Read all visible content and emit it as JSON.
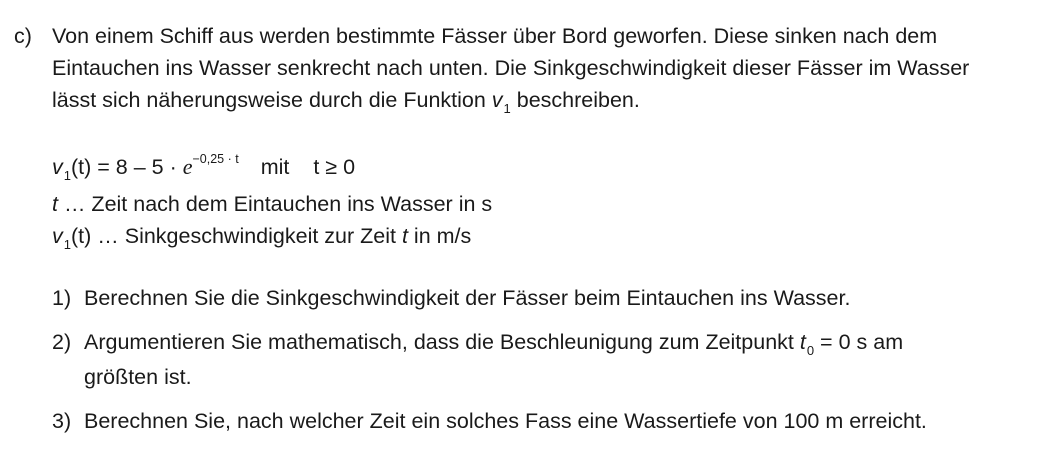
{
  "task": {
    "letter": "c)",
    "intro_lines": [
      "Von einem Schiff aus werden bestimmte Fässer über Bord geworfen. Diese sinken nach dem",
      "Eintauchen ins Wasser senkrecht nach unten. Die Sinkgeschwindigkeit dieser Fässer im Wasser"
    ],
    "intro_line3_before": "lässt sich näherungsweise durch die Funktion ",
    "intro_line3_after": " beschreiben.",
    "function_var": "v",
    "function_sub": "1"
  },
  "formula": {
    "lhs_var": "v",
    "lhs_sub": "1",
    "lhs_arg": "(t)",
    "equals_rhs": " = 8 – 5 · ",
    "exp_base": "e",
    "exponent": "−0,25 · t",
    "mit": "mit",
    "condition": "t ≥ 0"
  },
  "definitions": {
    "t_symbol": "t",
    "t_text": " … Zeit nach dem Eintauchen ins Wasser in s",
    "v_symbol": "v",
    "v_sub": "1",
    "v_arg": "(t)",
    "v_text_before": " … Sinkgeschwindigkeit zur Zeit ",
    "v_text_t": "t",
    "v_text_after": " in m/s"
  },
  "items": [
    {
      "num": "1)",
      "text": "Berechnen Sie die Sinkgeschwindigkeit der Fässer beim Eintauchen ins Wasser."
    },
    {
      "num": "2)",
      "text_before": "Argumentieren Sie mathematisch, dass die Beschleunigung zum Zeitpunkt ",
      "t0_var": "t",
      "t0_sub": "0",
      "text_after": " = 0 s  am",
      "line2": "größten ist."
    },
    {
      "num": "3)",
      "text": "Berechnen Sie, nach welcher Zeit ein solches Fass eine Wassertiefe von 100 m erreicht."
    }
  ]
}
